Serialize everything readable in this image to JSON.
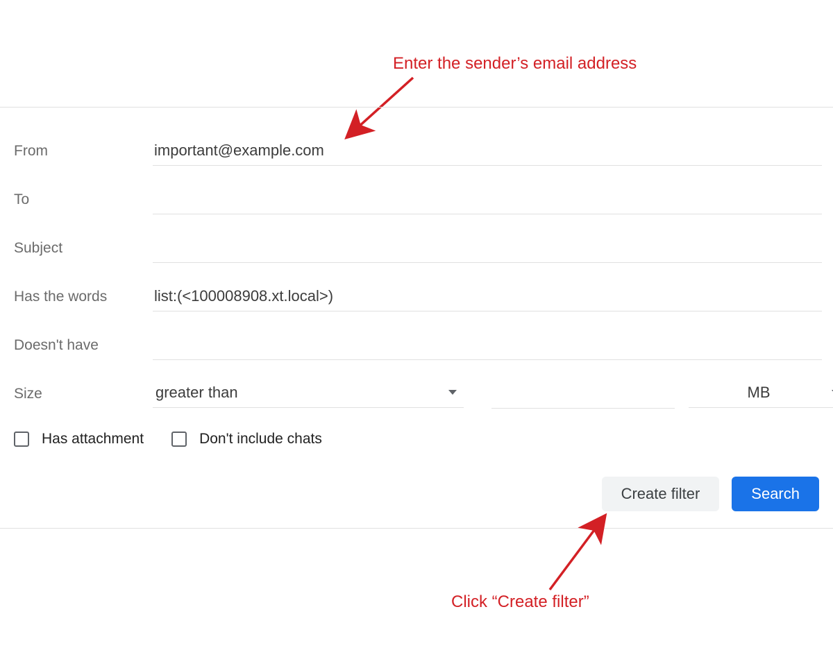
{
  "annotations": {
    "top": "Enter the sender’s email address",
    "bottom": "Click “Create filter”"
  },
  "form": {
    "from": {
      "label": "From",
      "value": "important@example.com"
    },
    "to": {
      "label": "To",
      "value": ""
    },
    "subject": {
      "label": "Subject",
      "value": ""
    },
    "has_words": {
      "label": "Has the words",
      "value": "list:(<100008908.xt.local>)"
    },
    "doesnt_have": {
      "label": "Doesn't have",
      "value": ""
    },
    "size": {
      "label": "Size",
      "operator": "greater than",
      "amount": "",
      "unit": "MB"
    },
    "checks": {
      "has_attachment": "Has attachment",
      "no_chats": "Don't include chats"
    }
  },
  "buttons": {
    "create_filter": "Create filter",
    "search": "Search"
  },
  "colors": {
    "accent_red": "#d32025",
    "primary_blue": "#1a73e8",
    "secondary_bg": "#f1f3f4"
  }
}
